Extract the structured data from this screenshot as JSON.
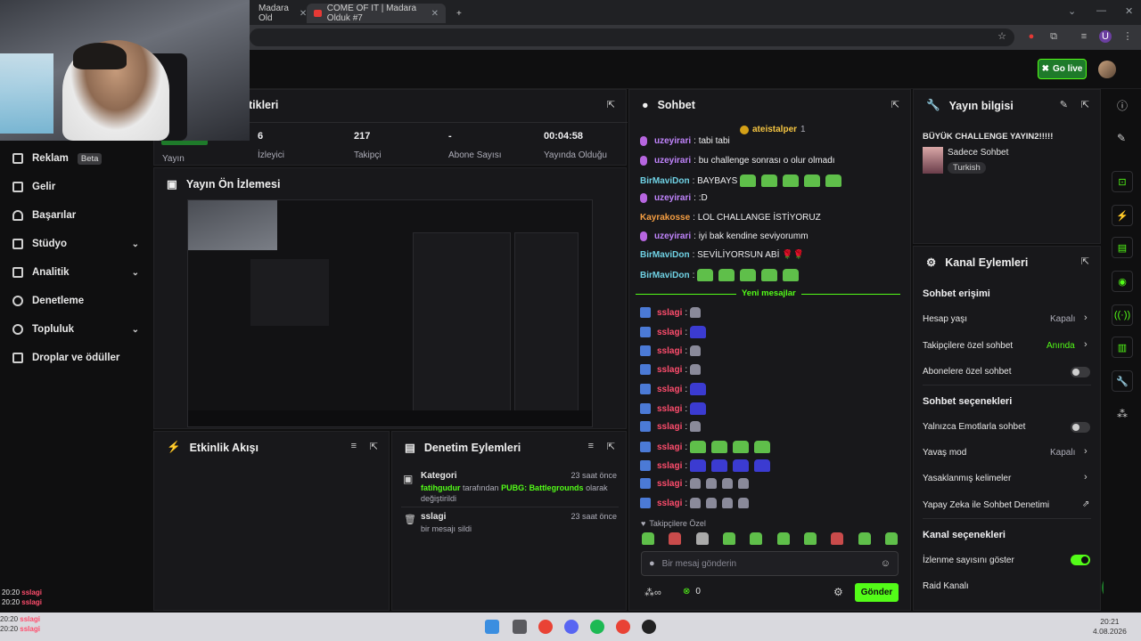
{
  "browser": {
    "tabs": [
      {
        "title": "Madara Old"
      },
      {
        "title": "COME OF IT | Madara Olduk #7"
      }
    ],
    "new_tab": "+"
  },
  "topbar": {
    "go_live": "Go live"
  },
  "sidebar": {
    "items": [
      {
        "label": "Reklam",
        "badge": "Beta"
      },
      {
        "label": "Gelir"
      },
      {
        "label": "Başarılar"
      },
      {
        "label": "Stüdyo"
      },
      {
        "label": "Analitik"
      },
      {
        "label": "Denetleme"
      },
      {
        "label": "Topluluk"
      },
      {
        "label": "Droplar ve ödüller"
      }
    ]
  },
  "stats": {
    "title": "tikleri",
    "items": [
      {
        "label": "Yayın",
        "value": ""
      },
      {
        "label": "İzleyici",
        "value": "6"
      },
      {
        "label": "Takipçi",
        "value": "217"
      },
      {
        "label": "Abone Sayısı",
        "value": "-"
      },
      {
        "label": "Yayında Olduğu",
        "value": "00:04:58"
      }
    ]
  },
  "preview": {
    "title": "Yayın Ön İzlemesi"
  },
  "activity": {
    "title": "Etkinlik Akışı"
  },
  "mod_actions": {
    "title": "Denetim Eylemleri",
    "items": [
      {
        "title": "Kategori",
        "time": "23 saat önce",
        "user": "fatihgudur",
        "text1": "tarafından",
        "category": "PUBG: Battlegrounds",
        "text2": "olarak değiştirildi"
      },
      {
        "title": "sslagi",
        "time": "23 saat önce",
        "text": "bir mesajı sildi"
      }
    ]
  },
  "chat": {
    "title": "Sohbet",
    "pinned_user": "ateistalper",
    "pinned_count": "1",
    "messages": [
      {
        "user": "uzeyirari",
        "text": ": tabi tabi"
      },
      {
        "user": "uzeyirari",
        "text": ": bu challenge sonrası o olur olmadı"
      },
      {
        "user": "BirMaviDon",
        "text": ": BAYBAYS"
      },
      {
        "user": "uzeyirari",
        "text": ": :D"
      },
      {
        "user": "Kayrakosse",
        "text": ": LOL CHALLANGE İSTİYORUZ"
      },
      {
        "user": "uzeyirari",
        "text": ": iyi bak kendine seviyorumm"
      },
      {
        "user": "BirMaviDon",
        "text": ": SEVİLİYORSUN ABİ"
      },
      {
        "user": "BirMaviDon",
        "text": ":"
      }
    ],
    "new_messages": "Yeni mesajlar",
    "spam_user": "sslagi",
    "followers_only": "Takipçilere Özel",
    "input_placeholder": "Bir mesaj gönderin",
    "send": "Gönder",
    "points": "0"
  },
  "stream_info": {
    "title": "Yayın bilgisi",
    "stream_title": "BÜYÜK CHALLENGE YAYIN2!!!!!",
    "category": "Sadece Sohbet",
    "language": "Turkish"
  },
  "channel_actions": {
    "title": "Kanal Eylemleri",
    "chat_access": "Sohbet erişimi",
    "account_age": "Hesap yaşı",
    "account_age_val": "Kapalı",
    "followers_chat": "Takipçilere özel sohbet",
    "followers_chat_val": "Anında",
    "subs_chat": "Abonelere özel sohbet",
    "chat_options": "Sohbet seçenekleri",
    "emote_only": "Yalnızca Emotlarla sohbet",
    "slow_mode": "Yavaş mod",
    "slow_mode_val": "Kapalı",
    "banned_words": "Yasaklanmış kelimeler",
    "ai_mod": "Yapay Zeka ile Sohbet Denetimi",
    "channel_options": "Kanal seçenekleri",
    "show_viewers": "İzlenme sayısını göster",
    "raid": "Raid Kanalı"
  },
  "taskbar": {
    "time": "20:21",
    "date": "4.08.2026"
  },
  "overlay_chat": [
    {
      "time": "20:20",
      "user": "sslagi"
    },
    {
      "time": "20:20",
      "user": "sslagi"
    },
    {
      "time": "20:20",
      "user": "sslagi"
    },
    {
      "time": "20:20",
      "user": "sslagi"
    }
  ],
  "colors": {
    "accent": "#53fc18",
    "panel": "#18181b",
    "bg": "#0f0f10"
  }
}
